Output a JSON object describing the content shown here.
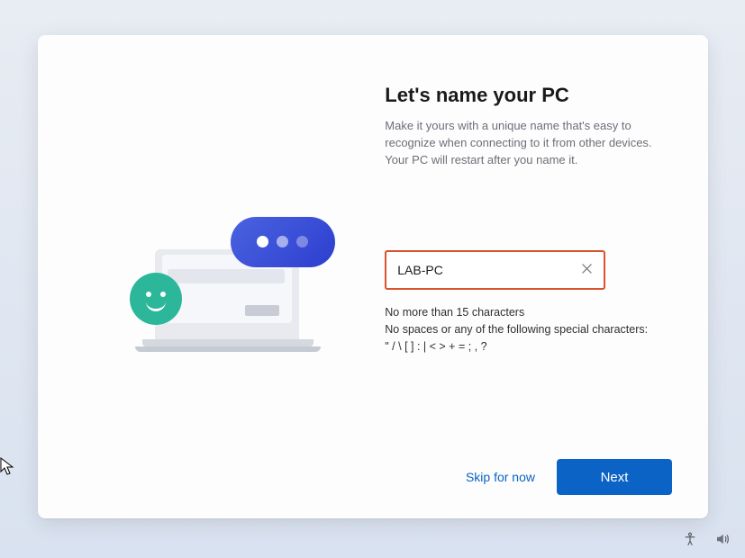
{
  "heading": "Let's name your PC",
  "subtitle": "Make it yours with a unique name that's easy to recognize when connecting to it from other devices. Your PC will restart after you name it.",
  "input": {
    "value": "LAB-PC",
    "placeholder": ""
  },
  "rules": {
    "line1": "No more than 15 characters",
    "line2": "No spaces or any of the following special characters:",
    "line3": "\" / \\ [ ] : | < > + = ; , ?"
  },
  "actions": {
    "skip": "Skip for now",
    "next": "Next"
  },
  "tray": {
    "accessibility": "accessibility-icon",
    "volume": "volume-icon"
  },
  "colors": {
    "accent": "#0b63c5",
    "highlight_border": "#d9532c"
  }
}
